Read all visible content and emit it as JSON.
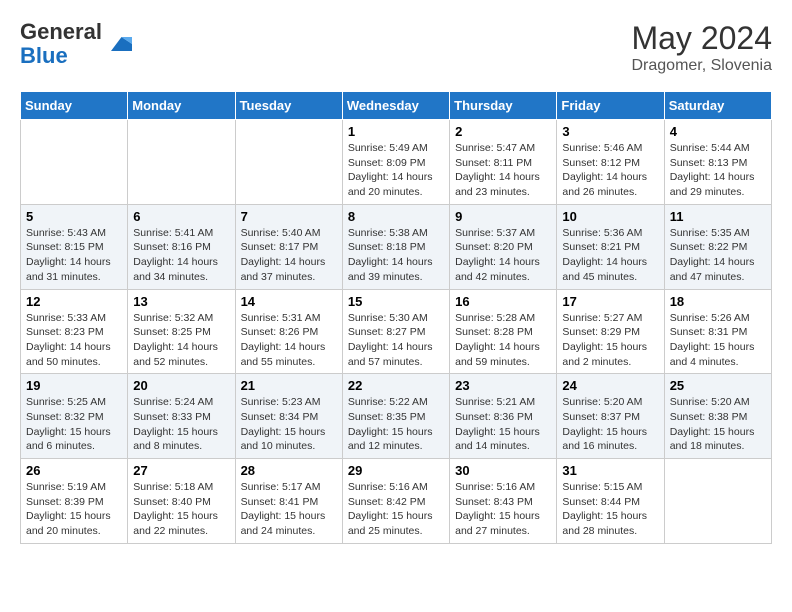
{
  "header": {
    "logo_general": "General",
    "logo_blue": "Blue",
    "month_year": "May 2024",
    "location": "Dragomer, Slovenia"
  },
  "weekdays": [
    "Sunday",
    "Monday",
    "Tuesday",
    "Wednesday",
    "Thursday",
    "Friday",
    "Saturday"
  ],
  "weeks": [
    [
      {
        "day": "",
        "info": ""
      },
      {
        "day": "",
        "info": ""
      },
      {
        "day": "",
        "info": ""
      },
      {
        "day": "1",
        "info": "Sunrise: 5:49 AM\nSunset: 8:09 PM\nDaylight: 14 hours\nand 20 minutes."
      },
      {
        "day": "2",
        "info": "Sunrise: 5:47 AM\nSunset: 8:11 PM\nDaylight: 14 hours\nand 23 minutes."
      },
      {
        "day": "3",
        "info": "Sunrise: 5:46 AM\nSunset: 8:12 PM\nDaylight: 14 hours\nand 26 minutes."
      },
      {
        "day": "4",
        "info": "Sunrise: 5:44 AM\nSunset: 8:13 PM\nDaylight: 14 hours\nand 29 minutes."
      }
    ],
    [
      {
        "day": "5",
        "info": "Sunrise: 5:43 AM\nSunset: 8:15 PM\nDaylight: 14 hours\nand 31 minutes."
      },
      {
        "day": "6",
        "info": "Sunrise: 5:41 AM\nSunset: 8:16 PM\nDaylight: 14 hours\nand 34 minutes."
      },
      {
        "day": "7",
        "info": "Sunrise: 5:40 AM\nSunset: 8:17 PM\nDaylight: 14 hours\nand 37 minutes."
      },
      {
        "day": "8",
        "info": "Sunrise: 5:38 AM\nSunset: 8:18 PM\nDaylight: 14 hours\nand 39 minutes."
      },
      {
        "day": "9",
        "info": "Sunrise: 5:37 AM\nSunset: 8:20 PM\nDaylight: 14 hours\nand 42 minutes."
      },
      {
        "day": "10",
        "info": "Sunrise: 5:36 AM\nSunset: 8:21 PM\nDaylight: 14 hours\nand 45 minutes."
      },
      {
        "day": "11",
        "info": "Sunrise: 5:35 AM\nSunset: 8:22 PM\nDaylight: 14 hours\nand 47 minutes."
      }
    ],
    [
      {
        "day": "12",
        "info": "Sunrise: 5:33 AM\nSunset: 8:23 PM\nDaylight: 14 hours\nand 50 minutes."
      },
      {
        "day": "13",
        "info": "Sunrise: 5:32 AM\nSunset: 8:25 PM\nDaylight: 14 hours\nand 52 minutes."
      },
      {
        "day": "14",
        "info": "Sunrise: 5:31 AM\nSunset: 8:26 PM\nDaylight: 14 hours\nand 55 minutes."
      },
      {
        "day": "15",
        "info": "Sunrise: 5:30 AM\nSunset: 8:27 PM\nDaylight: 14 hours\nand 57 minutes."
      },
      {
        "day": "16",
        "info": "Sunrise: 5:28 AM\nSunset: 8:28 PM\nDaylight: 14 hours\nand 59 minutes."
      },
      {
        "day": "17",
        "info": "Sunrise: 5:27 AM\nSunset: 8:29 PM\nDaylight: 15 hours\nand 2 minutes."
      },
      {
        "day": "18",
        "info": "Sunrise: 5:26 AM\nSunset: 8:31 PM\nDaylight: 15 hours\nand 4 minutes."
      }
    ],
    [
      {
        "day": "19",
        "info": "Sunrise: 5:25 AM\nSunset: 8:32 PM\nDaylight: 15 hours\nand 6 minutes."
      },
      {
        "day": "20",
        "info": "Sunrise: 5:24 AM\nSunset: 8:33 PM\nDaylight: 15 hours\nand 8 minutes."
      },
      {
        "day": "21",
        "info": "Sunrise: 5:23 AM\nSunset: 8:34 PM\nDaylight: 15 hours\nand 10 minutes."
      },
      {
        "day": "22",
        "info": "Sunrise: 5:22 AM\nSunset: 8:35 PM\nDaylight: 15 hours\nand 12 minutes."
      },
      {
        "day": "23",
        "info": "Sunrise: 5:21 AM\nSunset: 8:36 PM\nDaylight: 15 hours\nand 14 minutes."
      },
      {
        "day": "24",
        "info": "Sunrise: 5:20 AM\nSunset: 8:37 PM\nDaylight: 15 hours\nand 16 minutes."
      },
      {
        "day": "25",
        "info": "Sunrise: 5:20 AM\nSunset: 8:38 PM\nDaylight: 15 hours\nand 18 minutes."
      }
    ],
    [
      {
        "day": "26",
        "info": "Sunrise: 5:19 AM\nSunset: 8:39 PM\nDaylight: 15 hours\nand 20 minutes."
      },
      {
        "day": "27",
        "info": "Sunrise: 5:18 AM\nSunset: 8:40 PM\nDaylight: 15 hours\nand 22 minutes."
      },
      {
        "day": "28",
        "info": "Sunrise: 5:17 AM\nSunset: 8:41 PM\nDaylight: 15 hours\nand 24 minutes."
      },
      {
        "day": "29",
        "info": "Sunrise: 5:16 AM\nSunset: 8:42 PM\nDaylight: 15 hours\nand 25 minutes."
      },
      {
        "day": "30",
        "info": "Sunrise: 5:16 AM\nSunset: 8:43 PM\nDaylight: 15 hours\nand 27 minutes."
      },
      {
        "day": "31",
        "info": "Sunrise: 5:15 AM\nSunset: 8:44 PM\nDaylight: 15 hours\nand 28 minutes."
      },
      {
        "day": "",
        "info": ""
      }
    ]
  ]
}
